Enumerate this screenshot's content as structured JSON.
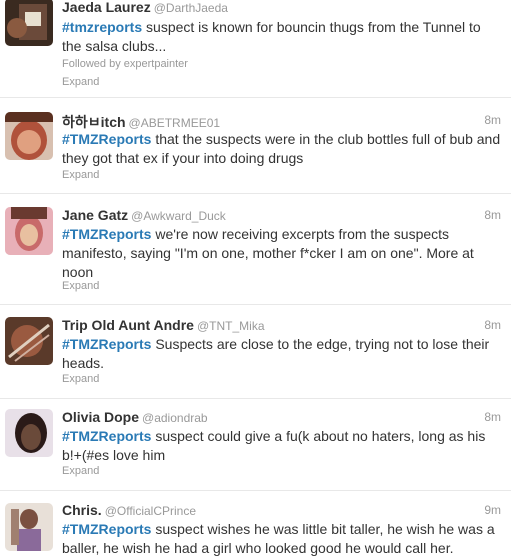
{
  "tweets": [
    {
      "name": "Jaeda Laurez",
      "handle": "@DarthJaeda",
      "time": "",
      "hashtag": "#tmzreports",
      "text": " suspect is known for bouncin thugs from the Tunnel to the salsa clubs...",
      "followed": "Followed by expertpainter",
      "expand": "Expand",
      "avatar_color": "#6b4a3a"
    },
    {
      "name": "하하ㅂitch",
      "handle": "@ABETRMEE01",
      "time": "8m",
      "hashtag": "#TMZReports",
      "text": " that the suspects were in the club bottles full of bub and they got that ex if your into doing drugs",
      "expand": "Expand",
      "avatar_color": "#b0523b"
    },
    {
      "name": "Jane Gatz",
      "handle": "@Awkward_Duck",
      "time": "8m",
      "hashtag": "#TMZReports",
      "text": " we're now receiving excerpts from the suspects manifesto, saying \"I'm on one, mother f*cker I am on one\". More at noon",
      "expand": "Expand",
      "avatar_color": "#c86a6a"
    },
    {
      "name": "Trip Old Aunt Andre",
      "handle": "@TNT_Mika",
      "time": "8m",
      "hashtag": "#TMZReports",
      "text": " Suspects are close to the edge,  trying not to lose their heads.",
      "expand": "Expand",
      "avatar_color": "#7a4a38"
    },
    {
      "name": "Olivia Dope",
      "handle": "@adiondrab",
      "time": "8m",
      "hashtag": "#TMZReports",
      "text": " suspect could give a fu(k about no haters, long as his b!+(#es love him",
      "expand": "Expand",
      "avatar_color": "#4a3630"
    },
    {
      "name": "Chris.",
      "handle": "@OfficialCPrince",
      "time": "9m",
      "hashtag": "#TMZReports",
      "text": " suspect wishes he was little bit taller, he wish he was a baller, he wish he had a girl who looked good he would call her.",
      "avatar_color": "#8a6a9a"
    }
  ]
}
